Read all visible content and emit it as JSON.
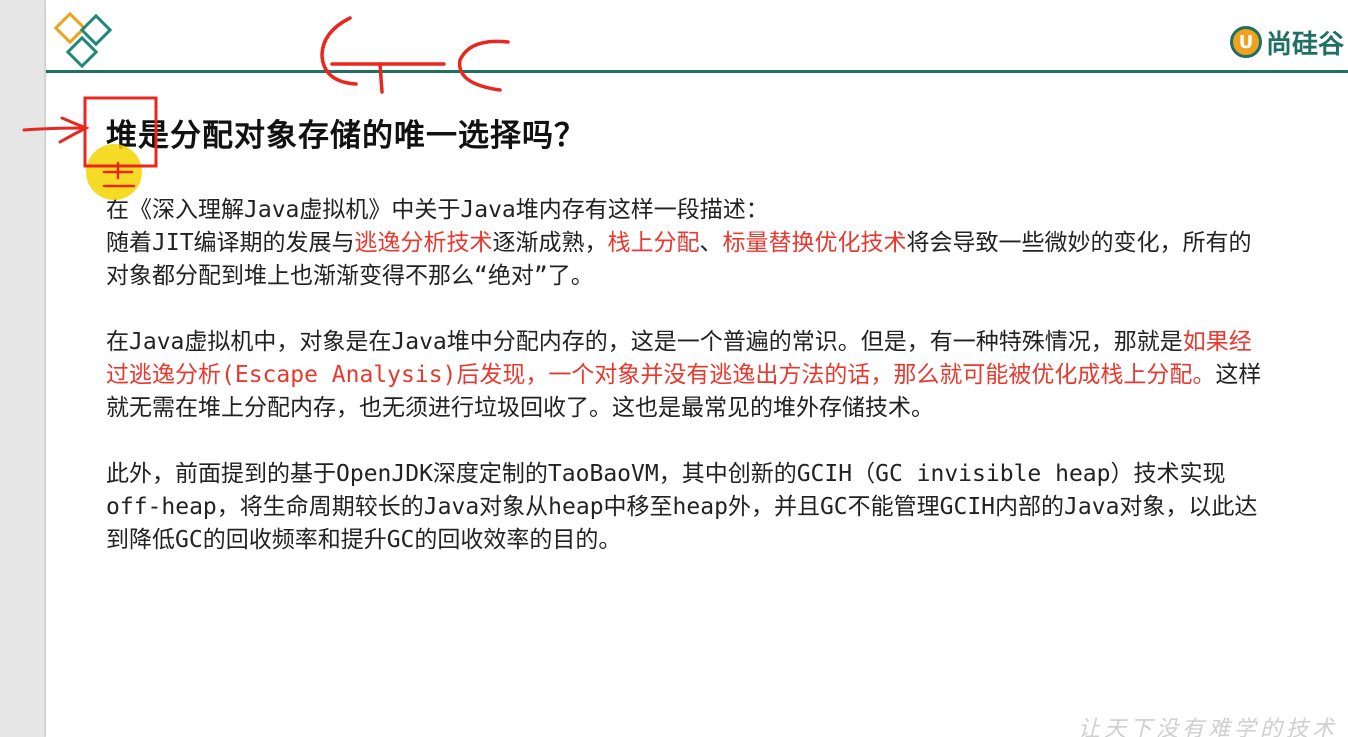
{
  "header": {
    "brand_text": "尚硅谷"
  },
  "title": "堆是分配对象存储的唯一选择吗？",
  "paragraphs": {
    "p1": {
      "line1": "在《深入理解Java虚拟机》中关于Java堆内存有这样一段描述：",
      "line2_a": "随着JIT编译期的发展与",
      "line2_red1": "逃逸分析技术",
      "line2_b": "逐渐成熟，",
      "line2_red2": "栈上分配",
      "line2_c": "、",
      "line2_red3": "标量替换优化技术",
      "line2_d": "将会导致一些微妙的变化，所有的对象都分配到堆上也渐渐变得不那么“绝对”了。"
    },
    "p2": {
      "a": "在Java虚拟机中，对象是在Java堆中分配内存的，这是一个普遍的常识。但是，有一种特殊情况，那就是",
      "red": "如果经过逃逸分析(Escape Analysis)后发现，一个对象并没有逃逸出方法的话，那么就可能被优化成栈上分配。",
      "b": "这样就无需在堆上分配内存，也无须进行垃圾回收了。这也是最常见的堆外存储技术。"
    },
    "p3": {
      "text": "此外，前面提到的基于OpenJDK深度定制的TaoBaoVM，其中创新的GCIH（GC invisible heap）技术实现off-heap，将生命周期较长的Java对象从heap中移至heap外，并且GC不能管理GCIH内部的Java对象，以此达到降低GC的回收频率和提升GC的回收效率的目的。"
    }
  },
  "handwriting": {
    "note": "GC"
  },
  "colors": {
    "accent_teal": "#1f6f63",
    "accent_orange": "#f0a21c",
    "highlight_red": "#e8392f",
    "pen_red": "#e8271e",
    "cursor_yellow": "#f5d500"
  },
  "icons": {
    "logo": "diamond-logo-icon",
    "brand": "brand-logo-icon",
    "arrow": "red-arrow-annotation",
    "cursor": "cursor-highlight"
  }
}
